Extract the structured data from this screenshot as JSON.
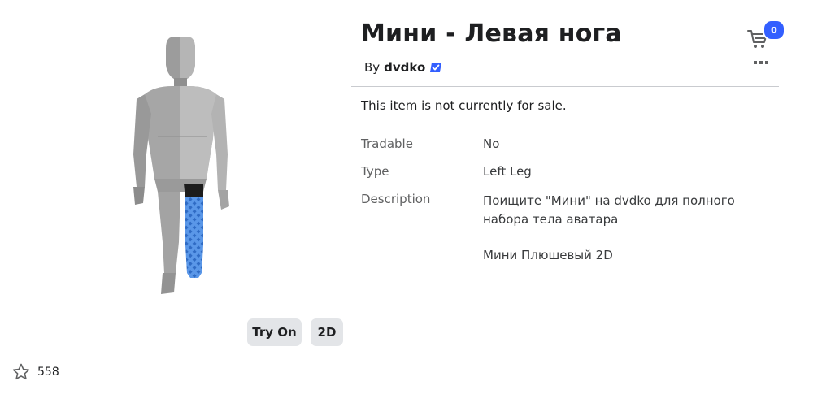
{
  "item": {
    "title": "Мини - Левая нога",
    "by_prefix": "By",
    "creator": "dvdko",
    "sale_status": "This item is not currently for sale."
  },
  "details": {
    "tradable_label": "Tradable",
    "tradable_value": "No",
    "type_label": "Type",
    "type_value": "Left Leg",
    "description_label": "Description",
    "description_line1": "Поищите \"Мини\" на dvdko для полного набора тела аватара",
    "description_line2": "Мини Плюшевый 2D"
  },
  "preview": {
    "try_on_label": "Try On",
    "view_2d_label": "2D"
  },
  "favorites": {
    "count": "558"
  },
  "cart": {
    "count": "0"
  },
  "colors": {
    "accent": "#335fff",
    "leg": "#4a86d9",
    "body": "#a8a8a8"
  },
  "icons": {
    "cart": "shopping-cart-icon",
    "more": "more-options-icon",
    "favorite": "star-outline-icon",
    "verified": "verified-badge-icon"
  }
}
